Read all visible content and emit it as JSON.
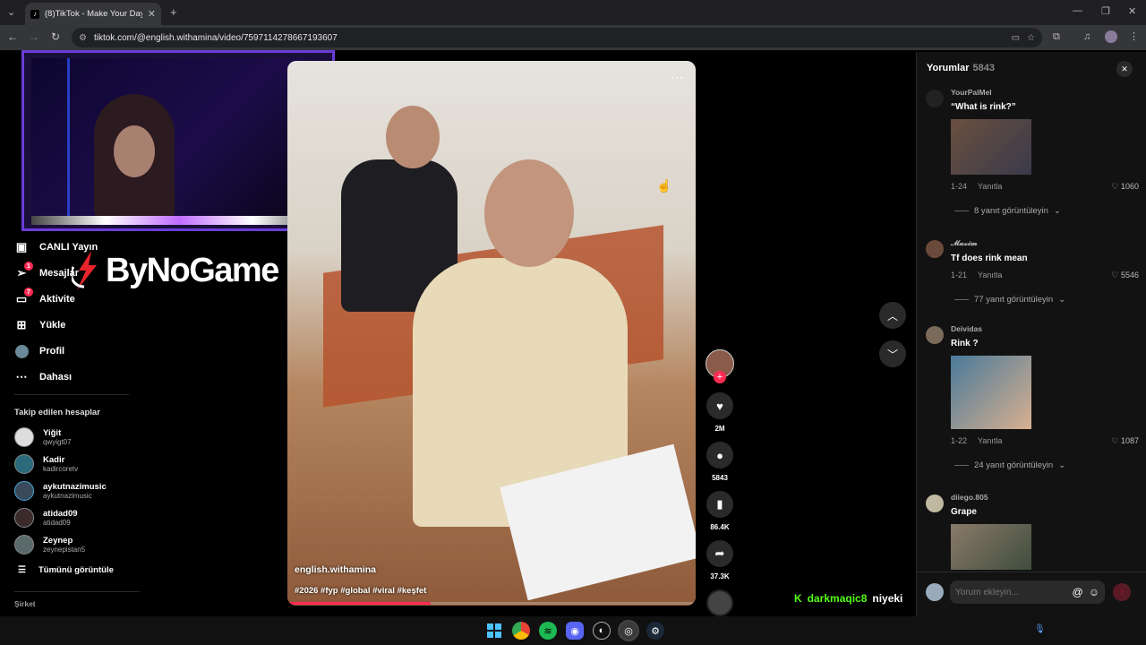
{
  "browser": {
    "tab_title": "(8)TikTok - Make Your Day",
    "url": "tiktok.com/@english.withamina/video/7597114278667193607"
  },
  "sidebar": {
    "items": [
      {
        "label": "CANLI Yayın",
        "icon": "live-icon"
      },
      {
        "label": "Mesajlar",
        "icon": "paper-plane-icon",
        "badge": "1"
      },
      {
        "label": "Aktivite",
        "icon": "activity-icon",
        "badge": "7"
      },
      {
        "label": "Yükle",
        "icon": "upload-icon"
      },
      {
        "label": "Profil",
        "icon": "profile-icon"
      },
      {
        "label": "Dahası",
        "icon": "more-icon"
      }
    ],
    "following_title": "Takip edilen hesaplar",
    "accounts": [
      {
        "name": "Yiğit",
        "handle": "qwyigt07"
      },
      {
        "name": "Kadir",
        "handle": "kadircoretv"
      },
      {
        "name": "aykutnazimusic",
        "handle": "aykutnazimusic"
      },
      {
        "name": "atidad09",
        "handle": "atidad09"
      },
      {
        "name": "Zeynep",
        "handle": "zeynepistan5"
      }
    ],
    "see_all": "Tümünü görüntüle",
    "footer_cut": "Şirket"
  },
  "overlay": {
    "brand": "ByNoGame"
  },
  "video": {
    "author": "english.withamina",
    "hashtags": "#2026 #fyp #global #viral #keşfet",
    "progress": 0.35
  },
  "actions": {
    "likes": "2M",
    "comments": "5843",
    "saves": "86.4K",
    "shares": "37.3K"
  },
  "chat_ticker": {
    "user": "darkmaqic8",
    "message": "niyeki"
  },
  "comments": {
    "title": "Yorumlar",
    "count": "5843",
    "items": [
      {
        "user": "YourPalMel",
        "text": "“What is rink?”",
        "date": "1-24",
        "reply_label": "Yanıtla",
        "likes": "1060",
        "replies": "8 yanıt görüntüleyin",
        "has_image": true
      },
      {
        "user": "𝓜𝓪𝔁𝓲𝓶",
        "text": "Tf does rink mean",
        "date": "1-21",
        "reply_label": "Yanıtla",
        "likes": "5546",
        "replies": "77 yanıt görüntüleyin",
        "has_image": false
      },
      {
        "user": "Deividas",
        "text": "Rink ?",
        "date": "1-22",
        "reply_label": "Yanıtla",
        "likes": "1087",
        "replies": "24 yanıt görüntüleyin",
        "has_image": true
      },
      {
        "user": "diiego.805",
        "text": "Grape",
        "has_image": true
      }
    ],
    "input_placeholder": "Yorum ekleyin..."
  }
}
